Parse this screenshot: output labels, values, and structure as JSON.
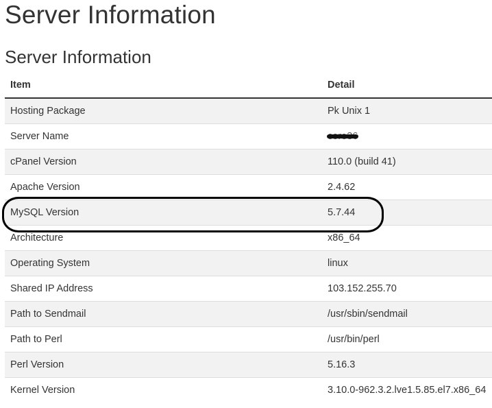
{
  "page": {
    "title": "Server Information"
  },
  "section": {
    "title": "Server Information"
  },
  "table": {
    "headers": {
      "item": "Item",
      "detail": "Detail"
    },
    "rows": [
      {
        "item": "Hosting Package",
        "detail": "Pk Unix 1"
      },
      {
        "item": "Server Name",
        "detail": "core36",
        "redacted": true
      },
      {
        "item": "cPanel Version",
        "detail": "110.0 (build 41)"
      },
      {
        "item": "Apache Version",
        "detail": "2.4.62"
      },
      {
        "item": "MySQL Version",
        "detail": "5.7.44",
        "highlighted": true
      },
      {
        "item": "Architecture",
        "detail": "x86_64"
      },
      {
        "item": "Operating System",
        "detail": "linux"
      },
      {
        "item": "Shared IP Address",
        "detail": "103.152.255.70"
      },
      {
        "item": "Path to Sendmail",
        "detail": "/usr/sbin/sendmail"
      },
      {
        "item": "Path to Perl",
        "detail": "/usr/bin/perl"
      },
      {
        "item": "Perl Version",
        "detail": "5.16.3"
      },
      {
        "item": "Kernel Version",
        "detail": "3.10.0-962.3.2.lve1.5.85.el7.x86_64"
      }
    ]
  },
  "colors": {
    "text": "#333333",
    "row_stripe": "#f2f2f2",
    "row_border": "#dddddd",
    "annotation": "#000000"
  }
}
